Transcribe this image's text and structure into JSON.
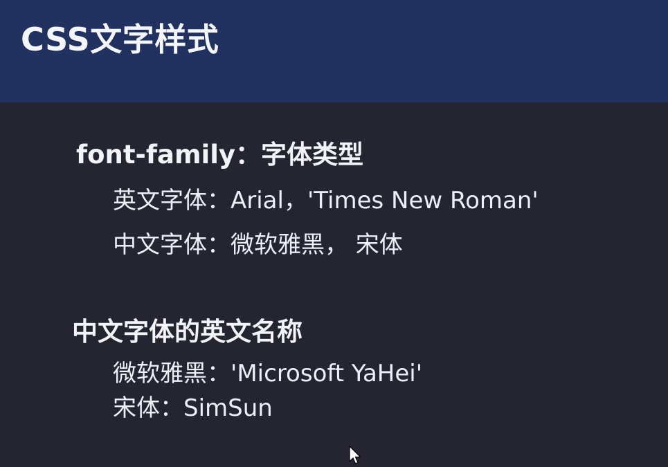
{
  "slide": {
    "title": "CSS文字样式",
    "sections": [
      {
        "heading": "font-family：字体类型",
        "lines": [
          "英文字体：Arial，'Times New Roman'",
          "中文字体：微软雅黑， 宋体"
        ]
      },
      {
        "heading": "中文字体的英文名称",
        "lines": [
          "微软雅黑：'Microsoft YaHei'",
          "宋体：SimSun"
        ]
      }
    ]
  },
  "icons": {
    "cursor": "mouse-pointer-icon"
  }
}
